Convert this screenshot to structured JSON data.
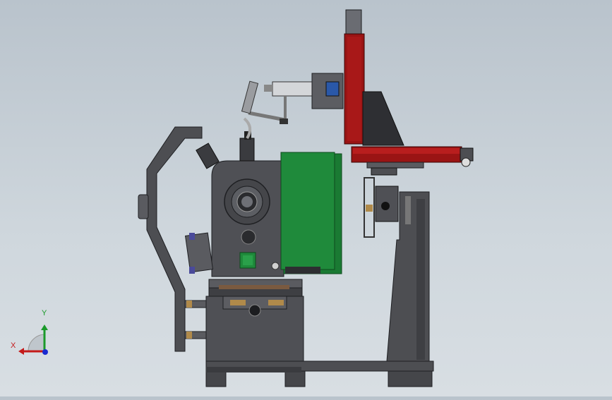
{
  "colors": {
    "background": "#c6cfd6",
    "frame": "#4d4e52",
    "frame_dark": "#2e2f33",
    "frame_light": "#6a6c72",
    "guard_green": "#1f8a3b",
    "arm_red": "#9a1414",
    "bronze": "#b08a4a",
    "axis_x": "#c41a1a",
    "axis_y": "#1a9a2a",
    "axis_z": "#1a2ad0"
  },
  "triad": {
    "x_label": "X",
    "y_label": "Y"
  }
}
